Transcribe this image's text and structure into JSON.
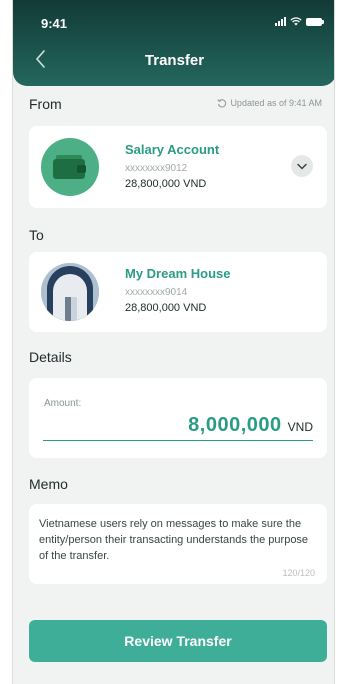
{
  "status": {
    "time": "9:41"
  },
  "header": {
    "title": "Transfer"
  },
  "from": {
    "label": "From",
    "updated": "Updated as of 9:41 AM",
    "account": {
      "name": "Salary Account",
      "number": "xxxxxxxx9012",
      "balance": "28,800,000 VND"
    }
  },
  "to": {
    "label": "To",
    "account": {
      "name": "My Dream House",
      "number": "xxxxxxxx9014",
      "balance": "28,800,000 VND"
    }
  },
  "details": {
    "label": "Details",
    "amount_label": "Amount:",
    "amount_value": "8,000,000",
    "amount_unit": "VND"
  },
  "memo": {
    "label": "Memo",
    "text": "Vietnamese users rely on messages to make sure the entity/person their transacting understands the purpose of the transfer.",
    "count": "120/120"
  },
  "actions": {
    "review_label": "Review Transfer"
  },
  "colors": {
    "accent": "#2a9c85",
    "button": "#3fae98",
    "header": "#1e5a52"
  }
}
